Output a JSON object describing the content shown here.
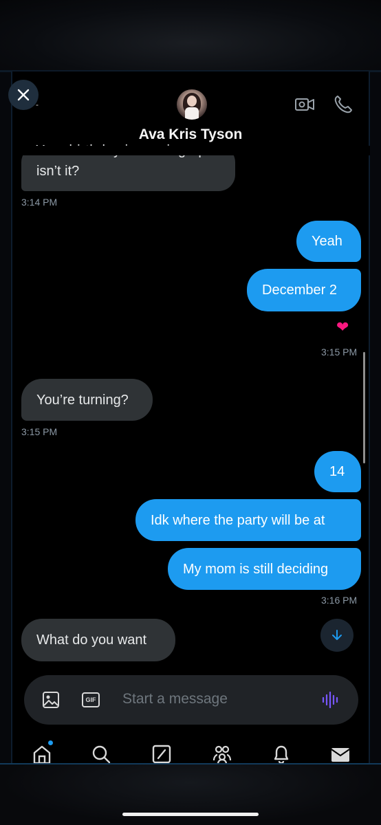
{
  "header": {
    "contact_name": "Ava Kris Tyson",
    "icons": [
      "close-icon",
      "video-call-icon",
      "phone-icon"
    ]
  },
  "messages": {
    "m1_partial": "Your birthday is coming up",
    "m1": "isn’t it?",
    "t1": "3:14 PM",
    "m2": "Yeah",
    "m3": "December 2",
    "reaction": "❤",
    "t2": "3:15 PM",
    "m4": "You’re turning?",
    "t3": "3:15 PM",
    "m5": "14",
    "m6": "Idk where the party will be at",
    "m7": "My mom is still deciding",
    "t4": "3:16 PM",
    "m8": "What do you want"
  },
  "composer": {
    "placeholder": "Start a message",
    "gif_label": "GIF"
  },
  "nav": {
    "items": [
      "home-icon",
      "search-icon",
      "grok-icon",
      "communities-icon",
      "notifications-icon",
      "messages-icon"
    ]
  },
  "colors": {
    "sent_bubble": "#1d9bf0",
    "received_bubble": "#2f3336",
    "background": "#000000"
  }
}
